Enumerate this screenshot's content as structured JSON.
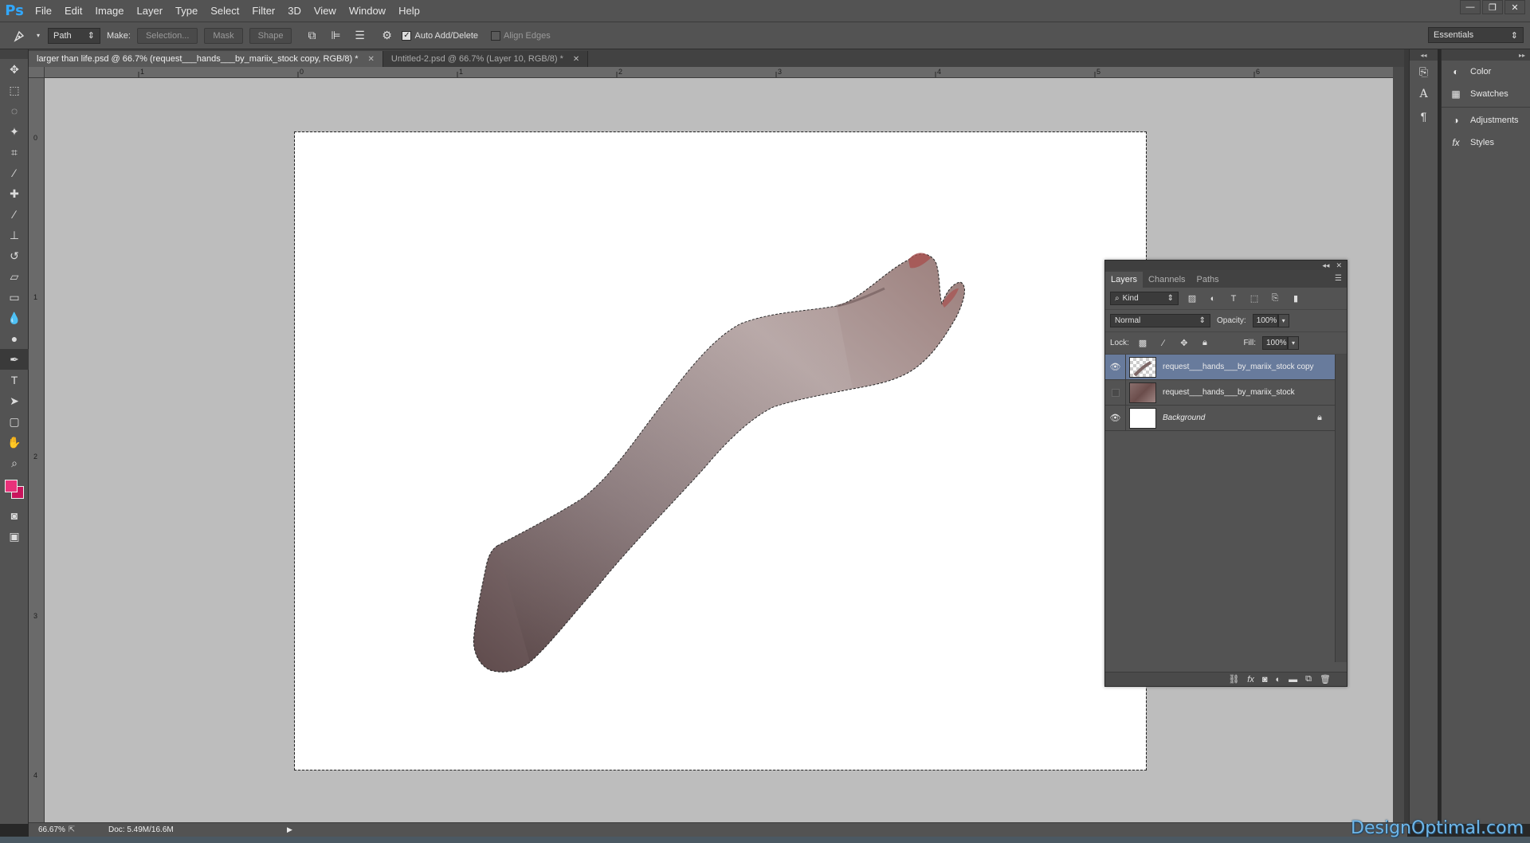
{
  "app": {
    "logo": "Ps",
    "menu": [
      "File",
      "Edit",
      "Image",
      "Layer",
      "Type",
      "Select",
      "Filter",
      "3D",
      "View",
      "Window",
      "Help"
    ],
    "window_controls": [
      "—",
      "❐",
      "✕"
    ]
  },
  "options": {
    "tool_mode": "Path",
    "make_label": "Make:",
    "selection_button": "Selection...",
    "mask_button": "Mask",
    "shape_button": "Shape",
    "auto_add_delete": "Auto Add/Delete",
    "auto_add_delete_checked": true,
    "align_edges": "Align Edges",
    "align_edges_checked": false,
    "workspace": "Essentials"
  },
  "tabs": [
    {
      "label": "larger than life.psd @ 66.7% (request___hands___by_mariix_stock copy, RGB/8) *",
      "active": true
    },
    {
      "label": "Untitled-2.psd @ 66.7% (Layer 10, RGB/8) *",
      "active": false
    }
  ],
  "rulers": {
    "top": [
      "1",
      "0",
      "1",
      "2",
      "3",
      "4",
      "5",
      "6"
    ],
    "left": [
      "0",
      "1",
      "2",
      "3",
      "4"
    ]
  },
  "colors": {
    "foreground": "#e8317a",
    "background": "#c9145c",
    "selected_layer": "#687b9c"
  },
  "right_panels": [
    {
      "icon": "color-icon",
      "label": "Color"
    },
    {
      "icon": "swatches-icon",
      "label": "Swatches"
    },
    {
      "icon": "adjustments-icon",
      "label": "Adjustments"
    },
    {
      "icon": "styles-icon",
      "label": "Styles"
    }
  ],
  "layers_panel": {
    "tabs": [
      "Layers",
      "Channels",
      "Paths"
    ],
    "active_tab": "Layers",
    "filter_kind": "Kind",
    "blend_mode": "Normal",
    "opacity_label": "Opacity:",
    "opacity": "100%",
    "lock_label": "Lock:",
    "fill_label": "Fill:",
    "fill": "100%",
    "layers": [
      {
        "name": "request___hands___by_mariix_stock copy",
        "visible": true,
        "selected": true,
        "thumb": "checker"
      },
      {
        "name": "request___hands___by_mariix_stock",
        "visible": false,
        "selected": false,
        "thumb": "photo"
      },
      {
        "name": "Background",
        "visible": true,
        "selected": false,
        "thumb": "white",
        "locked": true
      }
    ]
  },
  "status": {
    "zoom": "66.67%",
    "doc": "Doc: 5.49M/16.6M"
  },
  "watermark": "DesignOptimal.com"
}
